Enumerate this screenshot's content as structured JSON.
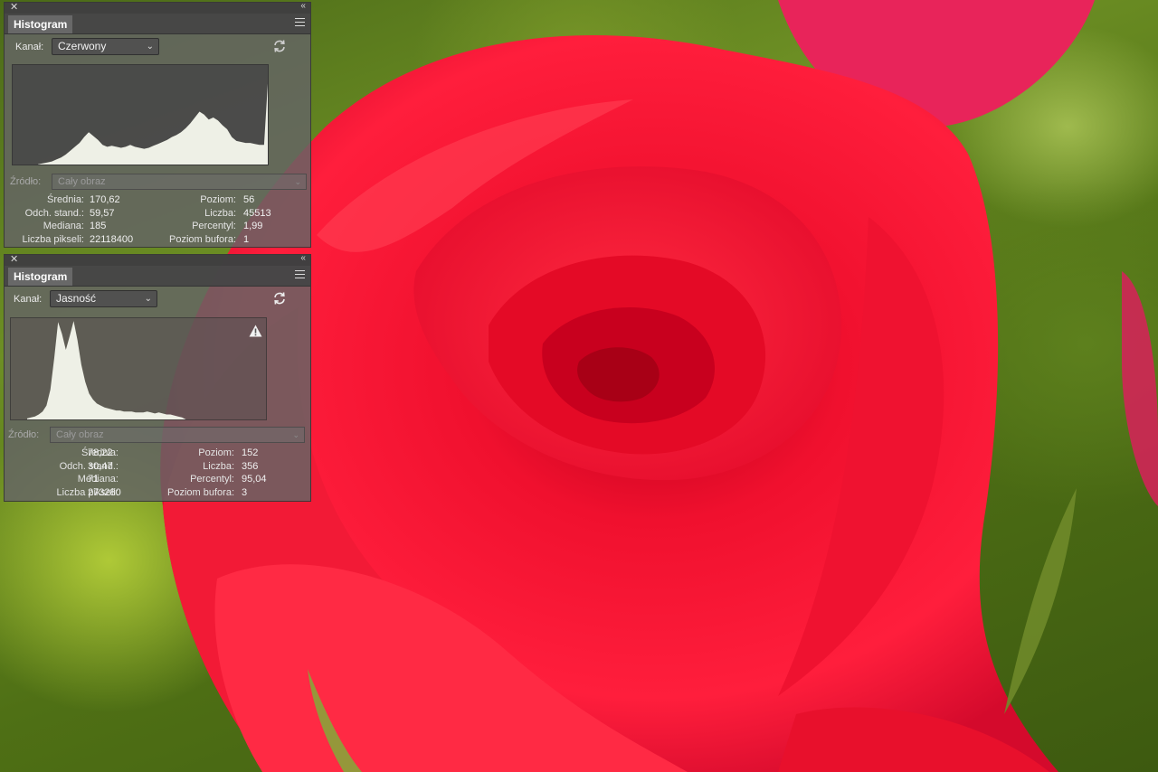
{
  "colors": {
    "panel_bg": "#646464",
    "histogram_fill": "#eef0e6",
    "rose": "#e8102a",
    "foliage": "#5a7a1c"
  },
  "panels": [
    {
      "tab_title": "Histogram",
      "channel_label": "Kanał:",
      "channel_value": "Czerwony",
      "source_label": "Źródło:",
      "source_value": "Cały obraz",
      "warning": false,
      "stats_left": [
        {
          "label": "Średnia:",
          "value": "170,62"
        },
        {
          "label": "Odch. stand.:",
          "value": "59,57"
        },
        {
          "label": "Mediana:",
          "value": "185"
        },
        {
          "label": "Liczba pikseli:",
          "value": "22118400"
        }
      ],
      "stats_right": [
        {
          "label": "Poziom:",
          "value": "56"
        },
        {
          "label": "Liczba:",
          "value": "45513"
        },
        {
          "label": "Percentyl:",
          "value": "1,99"
        },
        {
          "label": "Poziom bufora:",
          "value": "1"
        }
      ]
    },
    {
      "tab_title": "Histogram",
      "channel_label": "Kanał:",
      "channel_value": "Jasność",
      "source_label": "Źródło:",
      "source_value": "Cały obraz",
      "warning": true,
      "stats_left": [
        {
          "label": "Średnia:",
          "value": "78,22"
        },
        {
          "label": "Odch. stand.:",
          "value": "30,47"
        },
        {
          "label": "Mediana:",
          "value": "71"
        },
        {
          "label": "Liczba pikseli:",
          "value": "273280"
        }
      ],
      "stats_right": [
        {
          "label": "Poziom:",
          "value": "152"
        },
        {
          "label": "Liczba:",
          "value": "356"
        },
        {
          "label": "Percentyl:",
          "value": "95,04"
        },
        {
          "label": "Poziom bufora:",
          "value": "3"
        }
      ]
    }
  ],
  "histograms": [
    [
      0.02,
      0.03,
      0.04,
      0.05,
      0.07,
      0.09,
      0.12,
      0.16,
      0.2,
      0.24,
      0.3,
      0.35,
      0.31,
      0.27,
      0.22,
      0.2,
      0.21,
      0.2,
      0.19,
      0.2,
      0.22,
      0.2,
      0.19,
      0.18,
      0.19,
      0.21,
      0.23,
      0.25,
      0.27,
      0.3,
      0.32,
      0.35,
      0.39,
      0.44,
      0.5,
      0.56,
      0.53,
      0.48,
      0.5,
      0.47,
      0.42,
      0.38,
      0.3,
      0.26,
      0.25,
      0.24,
      0.24,
      0.23,
      0.22,
      0.22,
      1.0
    ],
    [
      0.01,
      0.02,
      0.03,
      0.05,
      0.08,
      0.14,
      0.3,
      0.62,
      0.98,
      0.86,
      0.7,
      0.84,
      0.99,
      0.8,
      0.55,
      0.38,
      0.26,
      0.2,
      0.16,
      0.14,
      0.12,
      0.11,
      0.1,
      0.09,
      0.09,
      0.08,
      0.08,
      0.08,
      0.07,
      0.07,
      0.07,
      0.08,
      0.07,
      0.06,
      0.07,
      0.06,
      0.05,
      0.05,
      0.04,
      0.03,
      0.02,
      0.0,
      0.0,
      0.0,
      0.0,
      0.0,
      0.0,
      0.0,
      0.0,
      0.0,
      0.0
    ]
  ]
}
